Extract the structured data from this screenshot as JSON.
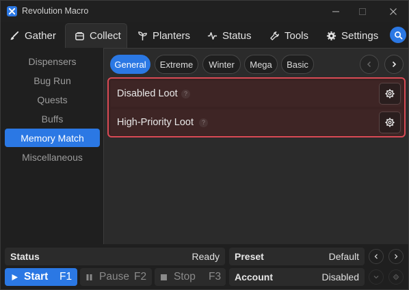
{
  "window": {
    "title": "Revolution Macro"
  },
  "nav": {
    "tabs": [
      {
        "label": "Gather",
        "icon": "brush-icon"
      },
      {
        "label": "Collect",
        "icon": "bag-icon"
      },
      {
        "label": "Planters",
        "icon": "sprout-icon"
      },
      {
        "label": "Status",
        "icon": "pulse-icon"
      },
      {
        "label": "Tools",
        "icon": "wrench-icon"
      },
      {
        "label": "Settings",
        "icon": "gear-icon"
      }
    ],
    "active": "Collect"
  },
  "sidebar": {
    "items": [
      {
        "label": "Dispensers"
      },
      {
        "label": "Bug Run"
      },
      {
        "label": "Quests"
      },
      {
        "label": "Buffs"
      },
      {
        "label": "Memory Match"
      },
      {
        "label": "Miscellaneous"
      }
    ],
    "active": "Memory Match"
  },
  "content": {
    "subtabs": [
      {
        "label": "General"
      },
      {
        "label": "Extreme"
      },
      {
        "label": "Winter"
      },
      {
        "label": "Mega"
      },
      {
        "label": "Basic"
      }
    ],
    "active_subtab": "General",
    "loot_rows": [
      {
        "label": "Disabled Loot",
        "help": "?"
      },
      {
        "label": "High-Priority Loot",
        "help": "?"
      }
    ],
    "highlight_color": "#d94a55"
  },
  "bottom": {
    "status": {
      "label": "Status",
      "value": "Ready"
    },
    "preset": {
      "label": "Preset",
      "value": "Default"
    },
    "account": {
      "label": "Account",
      "value": "Disabled"
    },
    "start": {
      "label": "Start",
      "hotkey": "F1"
    },
    "pause": {
      "label": "Pause",
      "hotkey": "F2"
    },
    "stop": {
      "label": "Stop",
      "hotkey": "F3"
    }
  },
  "colors": {
    "accent": "#2b78e4",
    "background": "#1f1f1f",
    "panel": "#2b2b2b"
  }
}
